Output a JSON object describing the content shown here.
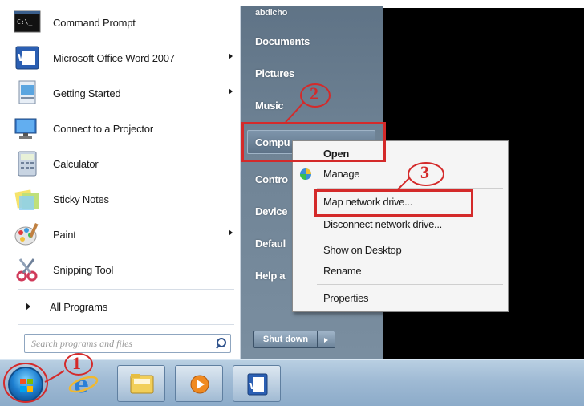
{
  "start_menu": {
    "programs": [
      {
        "label": "Command Prompt",
        "icon": "command-prompt-icon",
        "submenu": false
      },
      {
        "label": "Microsoft Office Word 2007",
        "icon": "word-icon",
        "submenu": true
      },
      {
        "label": "Getting Started",
        "icon": "getting-started-icon",
        "submenu": true
      },
      {
        "label": "Connect to a Projector",
        "icon": "projector-icon",
        "submenu": false
      },
      {
        "label": "Calculator",
        "icon": "calculator-icon",
        "submenu": false
      },
      {
        "label": "Sticky Notes",
        "icon": "sticky-notes-icon",
        "submenu": false
      },
      {
        "label": "Paint",
        "icon": "paint-icon",
        "submenu": true
      },
      {
        "label": "Snipping Tool",
        "icon": "snipping-tool-icon",
        "submenu": false
      }
    ],
    "all_programs_label": "All Programs",
    "search_placeholder": "Search programs and files",
    "right_items": {
      "user": "abdicho",
      "documents": "Documents",
      "pictures": "Pictures",
      "music": "Music",
      "computer": "Compu",
      "control_panel": "Contro",
      "devices": "Device",
      "default": "Defaul",
      "help": "Help a"
    },
    "shutdown_label": "Shut down"
  },
  "context_menu": {
    "items": {
      "open": "Open",
      "manage": "Manage",
      "map_network_drive": "Map network drive...",
      "disconnect_network_drive": "Disconnect network drive...",
      "show_on_desktop": "Show on Desktop",
      "rename": "Rename",
      "properties": "Properties"
    }
  },
  "annotations": {
    "step1": "1",
    "step2": "2",
    "step3": "3",
    "color": "#d42a2a"
  },
  "colors": {
    "right_panel": "#6f8395",
    "taskbar": "#9fbad4",
    "accent": "#1d7fd0"
  }
}
